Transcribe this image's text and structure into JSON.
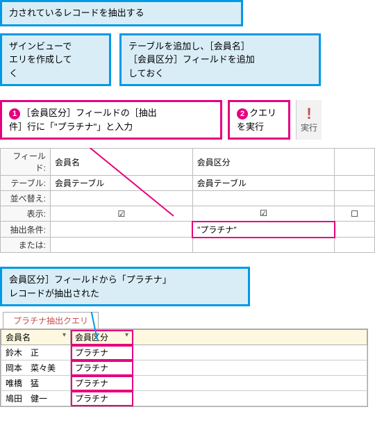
{
  "row1": {
    "text": "力されているレコードを抽出する"
  },
  "row2": {
    "left": "ザインビューで\nエリを作成して\nく",
    "right": "テーブルを追加し、［会員名］\n［会員区分］フィールドを追加\nしておく"
  },
  "row3": {
    "step1_num": "1",
    "step1_text": "［会員区分］フィールドの［抽出\n件］行に「\"プラチナ\"」と入力",
    "step2_num": "2",
    "step2_text": "クエリ\nを実行",
    "exec_label": "実行"
  },
  "design_grid": {
    "row_labels": [
      "フィールド:",
      "テーブル:",
      "並べ替え:",
      "表示:",
      "抽出条件:",
      "または:"
    ],
    "cols": [
      {
        "field": "会員名",
        "table": "会員テーブル",
        "show": true,
        "criteria": ""
      },
      {
        "field": "会員区分",
        "table": "会員テーブル",
        "show": true,
        "criteria": "\"プラチナ\""
      },
      {
        "field": "",
        "table": "",
        "show": false,
        "criteria": ""
      }
    ]
  },
  "row4": {
    "text": "会員区分］フィールドから「プラチナ」\nレコードが抽出された"
  },
  "result": {
    "tab": "プラチナ抽出クエリ",
    "headers": [
      "会員名",
      "会員区分"
    ],
    "rows": [
      [
        "鈴木　正",
        "プラチナ"
      ],
      [
        "岡本　菜々美",
        "プラチナ"
      ],
      [
        "唯橋　猛",
        "プラチナ"
      ],
      [
        "鳩田　健一",
        "プラチナ"
      ]
    ]
  }
}
